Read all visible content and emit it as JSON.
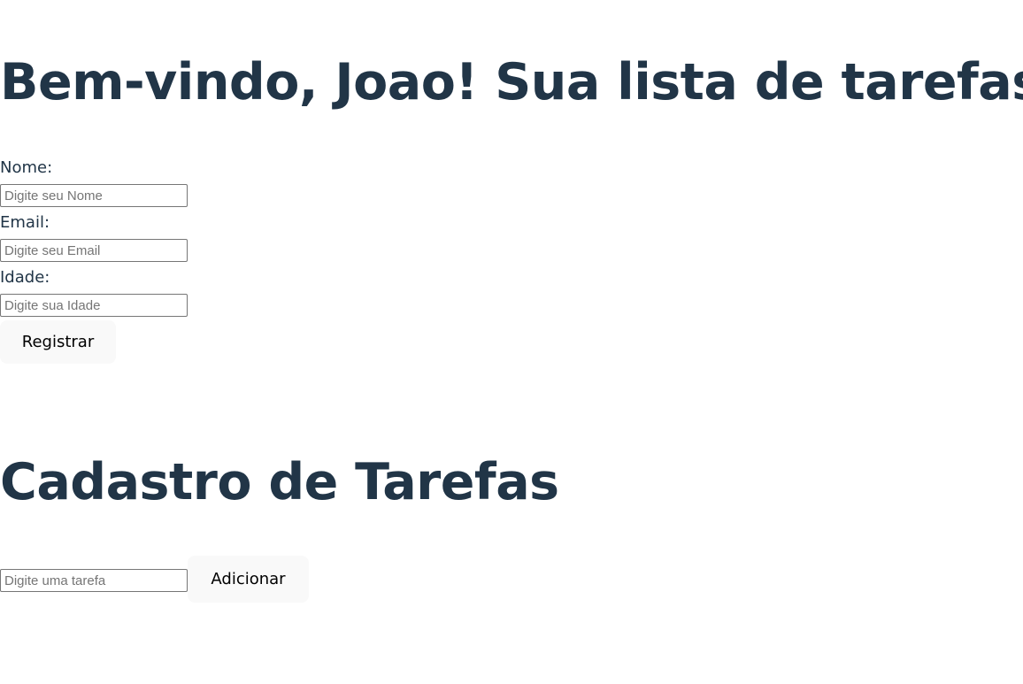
{
  "welcome": {
    "title": "Bem-vindo, Joao! Sua lista de tarefas"
  },
  "register_form": {
    "name_label": "Nome:",
    "name_placeholder": "Digite seu Nome",
    "email_label": "Email:",
    "email_placeholder": "Digite seu Email",
    "age_label": "Idade:",
    "age_placeholder": "Digite sua Idade",
    "submit_label": "Registrar"
  },
  "tasks": {
    "title": "Cadastro de Tarefas",
    "task_placeholder": "Digite uma tarefa",
    "add_label": "Adicionar"
  },
  "colors": {
    "heading": "#213547",
    "button_bg": "#f9f9f9",
    "input_border": "#767676"
  }
}
